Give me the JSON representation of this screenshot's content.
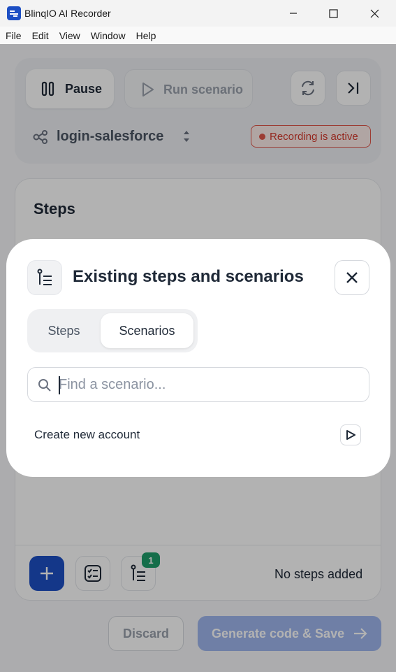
{
  "window": {
    "title": "BlinqIO AI Recorder"
  },
  "menu": [
    "File",
    "Edit",
    "View",
    "Window",
    "Help"
  ],
  "toolbar": {
    "pause_label": "Pause",
    "run_label": "Run scenario",
    "scenario_name": "login-salesforce",
    "recording_status": "Recording is active"
  },
  "steps_panel": {
    "title": "Steps",
    "empty_text": "No steps added",
    "badge_count": "1"
  },
  "footer": {
    "discard_label": "Discard",
    "generate_label": "Generate code & Save"
  },
  "modal": {
    "title": "Existing steps and scenarios",
    "tabs": [
      {
        "label": "Steps",
        "selected": false
      },
      {
        "label": "Scenarios",
        "selected": true
      }
    ],
    "search_placeholder": "Find a scenario...",
    "results": [
      {
        "label": "Create new account"
      }
    ]
  },
  "colors": {
    "accent": "#1d4fc4",
    "recording": "#e0574a",
    "badge": "#1e9e6a"
  }
}
